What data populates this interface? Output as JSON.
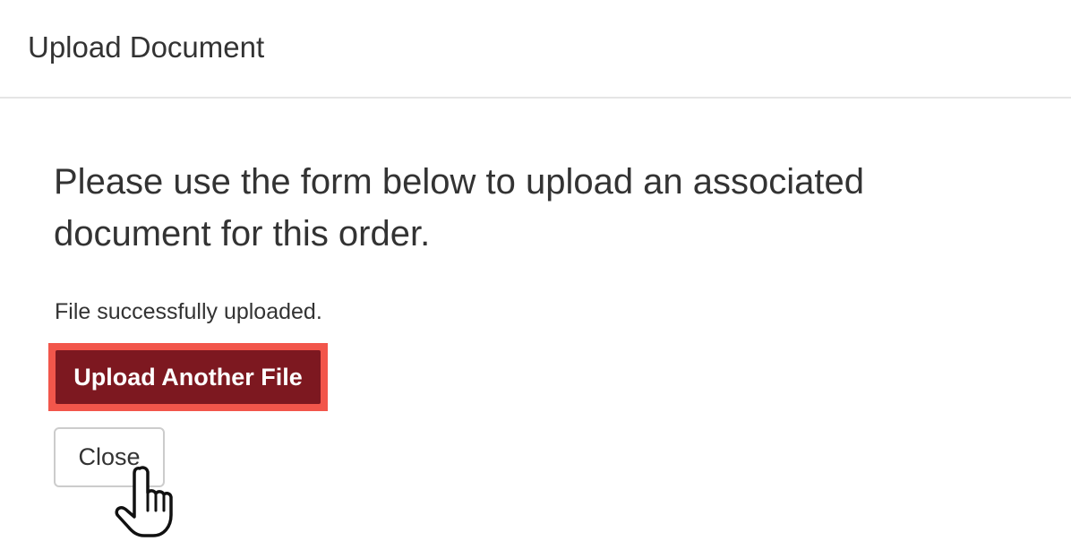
{
  "dialog": {
    "title": "Upload Document"
  },
  "body": {
    "intro": "Please use the form below to upload an associated document for this order.",
    "status": "File successfully uploaded."
  },
  "actions": {
    "upload_another_label": "Upload Another File",
    "close_label": "Close"
  },
  "colors": {
    "primary_button": "#7d1820",
    "highlight_outline": "#f2564b",
    "divider": "#e5e5e5"
  },
  "icons": {
    "cursor": "hand-pointer-icon"
  }
}
